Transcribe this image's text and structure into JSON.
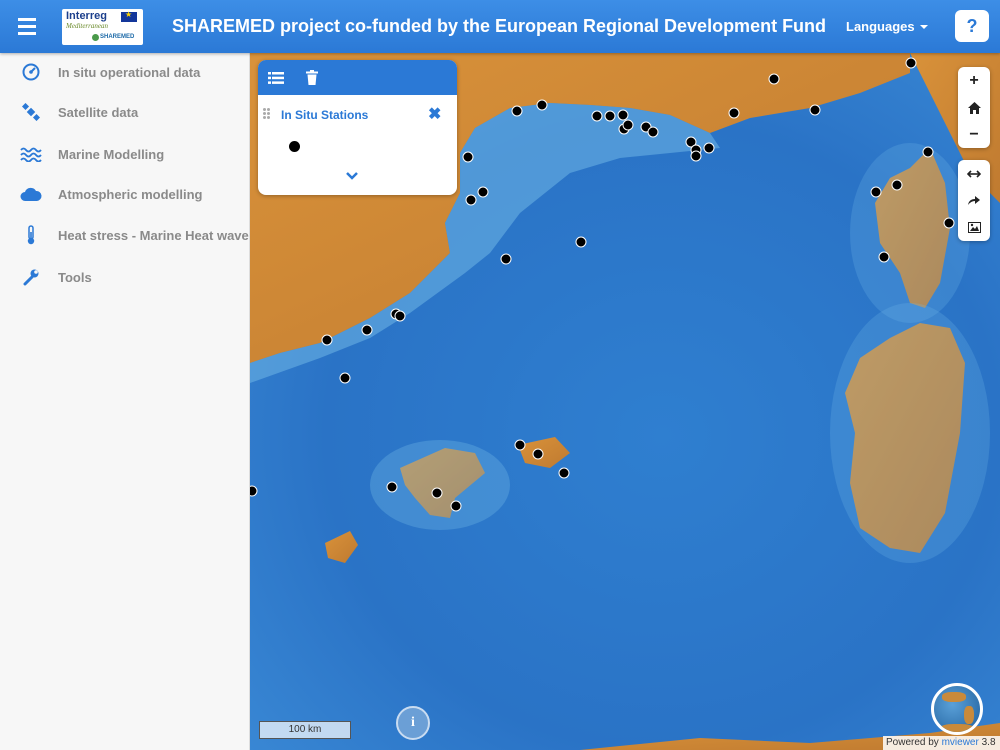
{
  "header": {
    "title": "SHAREMED project co-funded by the European Regional Development Fund",
    "languages_label": "Languages",
    "help_label": "?",
    "logo": {
      "line1": "Interreg",
      "line2": "Mediterranean",
      "line3": "SHAREMED"
    }
  },
  "sidebar": {
    "items": [
      {
        "label": "In situ operational data",
        "icon": "gauge-icon"
      },
      {
        "label": "Satellite data",
        "icon": "satellite-icon"
      },
      {
        "label": "Marine Modelling",
        "icon": "waves-icon"
      },
      {
        "label": "Atmospheric modelling",
        "icon": "cloud-icon"
      },
      {
        "label": "Heat stress - Marine Heat wave",
        "icon": "thermometer-icon"
      },
      {
        "label": "Tools",
        "icon": "wrench-icon"
      }
    ]
  },
  "layer_panel": {
    "layer_title": "In Situ Stations"
  },
  "map_controls": {
    "zoom_in": "+",
    "zoom_out": "−",
    "info": "i"
  },
  "scale_bar": {
    "label": "100 km"
  },
  "credits": {
    "prefix": "Powered by",
    "link": "mviewer",
    "version": "3.8"
  },
  "colors": {
    "accent": "#2b79d6",
    "sea_deep": "#1e63b8",
    "sea_shallow": "#6fb6e6",
    "land": "#d08a3a"
  }
}
